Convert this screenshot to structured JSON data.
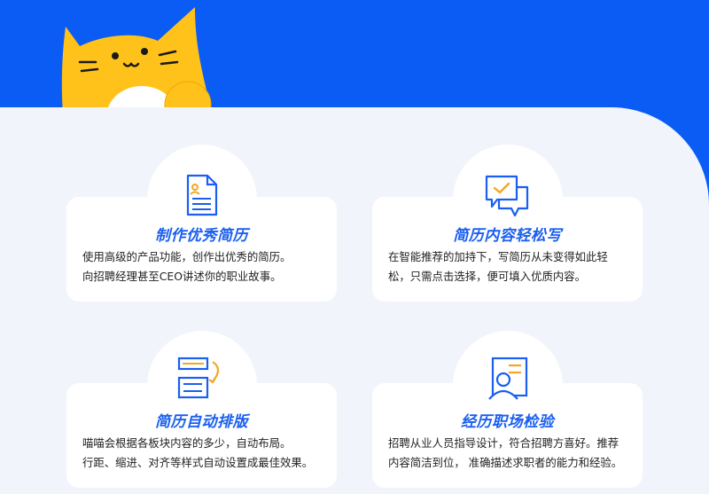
{
  "features": [
    {
      "icon": "resume-document-icon",
      "title": "制作优秀简历",
      "lines": [
        "使用高级的产品功能，创作出优秀的简历。",
        "向招聘经理甚至CEO讲述你的职业故事。"
      ]
    },
    {
      "icon": "chat-bubbles-icon",
      "title": "简历内容轻松写",
      "lines": [
        "在智能推荐的加持下，写简历从未变得如此轻",
        "松，只需点击选择，便可填入优质内容。"
      ]
    },
    {
      "icon": "auto-layout-icon",
      "title": "简历自动排版",
      "lines": [
        "喵喵会根据各板块内容的多少，自动布局。",
        "行距、缩进、对齐等样式自动设置成最佳效果。"
      ]
    },
    {
      "icon": "career-profile-icon",
      "title": "经历职场检验",
      "lines": [
        "招聘从业人员指导设计，符合招聘方喜好。推荐",
        "内容简洁到位， 准确描述求职者的能力和经验。"
      ]
    }
  ],
  "colors": {
    "blue": "#0a5cf5",
    "accent": "#1a5ff0",
    "panel": "#f1f4fb",
    "cat_yellow": "#ffc21a",
    "icon_orange": "#f5a623"
  }
}
